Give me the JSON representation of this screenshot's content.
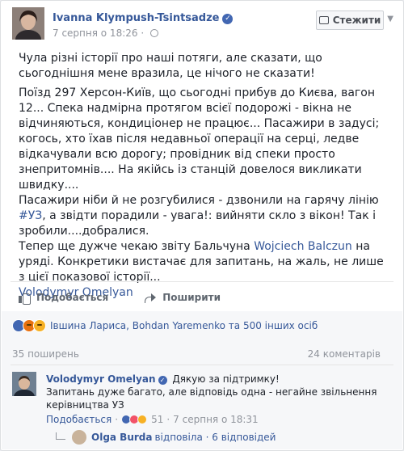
{
  "post": {
    "author": "Ivanna Klympush-Tsintsadze",
    "timestamp": "7 серпня о 18:26",
    "follow_label": "Стежити",
    "paragraphs": [
      "Чула різні історії про наші потяги, але сказати, що сьогоднішня мене вразила, це нічого не сказати!",
      "Поїзд 297 Херсон-Київ, що сьогодні прибув до Києва, вагон 12... Спека надмірна протягом всієї подорожі - вікна не відчиняються, кондиціонер не працює... Пасажири в задусі; когось, хто їхав після недавньої операції на серці, ледве відкачували всю дорогу; провідник від спеки просто знепритомнів.... На якійсь із станцій довелося викликати швидку....",
      {
        "before": "Пасажири ніби й не розгубилися - дзвонили на гарячу лінію ",
        "hashtag": "#УЗ",
        "after": ", а звідти порадили - увага!: вийняти скло з вікон! Так і зробили....добралися."
      },
      {
        "before": "Тепер ще дужче чекаю звіту Бальчуна ",
        "mention": "Wojciech Balczun",
        "after": " на уряді. Конкретики вистачає для запитань, на жаль, не лише з цієї показової історії..."
      }
    ],
    "tag": "Volodymyr Omelyan"
  },
  "actions": {
    "like_label": "Подобається",
    "share_label": "Поширити"
  },
  "reactions": {
    "names": "Івшина Лариса, Bohdan Yaremenko та 500 інших осіб",
    "shares": "35 поширень",
    "comments_count": "24 коментарів"
  },
  "comment": {
    "author": "Volodymyr Omelyan",
    "first_line": "Дякую за підтримку!",
    "text": "Запитань дуже багато, але відповідь одна - негайне звільнення керівництва УЗ",
    "like_label": "Подобається",
    "reaction_count": "51",
    "time": "7 серпня о 18:31",
    "reply_author": "Olga Burda",
    "reply_text": "відповіла · 6 відповідей"
  },
  "colors": {
    "link": "#365899",
    "like_reaction": "#4267b2",
    "angry_reaction": "#e9710f",
    "sad_reaction": "#f7b125"
  }
}
